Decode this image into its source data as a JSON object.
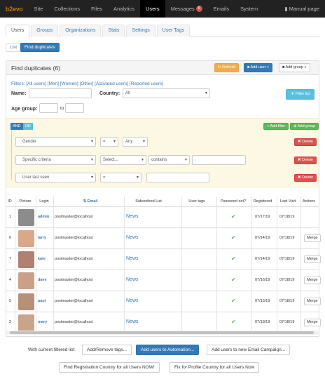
{
  "topbar": {
    "logo": "b2evo",
    "items": [
      "Site",
      "Collections",
      "Files",
      "Analytics",
      "Users",
      "Messages",
      "Emails",
      "System"
    ],
    "messages_badge": "6",
    "manual": "Manual page"
  },
  "tabs": [
    "Users",
    "Groups",
    "Organizations",
    "Stats",
    "Settings",
    "User Tags"
  ],
  "subtabs": [
    "List",
    "Find duplicates"
  ],
  "panel": {
    "title": "Find duplicates (6)",
    "refresh": "Refresh",
    "add_user": "Add user »",
    "add_group": "Add group »"
  },
  "filters": {
    "label": "Filters:",
    "links": [
      "[All users]",
      "[Men]",
      "[Women]",
      "[Other]",
      "[Activated users]",
      "[Reported users]"
    ],
    "name_label": "Name:",
    "country_label": "Country:",
    "country_value": "All",
    "filter_btn": "Filter list",
    "age_label": "Age group:",
    "age_to": "to"
  },
  "query": {
    "and": "AND",
    "or": "OR",
    "add_filter": "Add filter",
    "add_group": "Add group",
    "rules": [
      {
        "field": "Gender",
        "op": "=",
        "value": "Any",
        "extra": "",
        "delete": "Delete"
      },
      {
        "field": "Specific criteria",
        "op": "Select...",
        "value": "contains",
        "extra": "",
        "delete": "Delete"
      },
      {
        "field": "User last seen",
        "op": "=",
        "value": "",
        "extra": "",
        "delete": "Delete"
      }
    ]
  },
  "table": {
    "headers": [
      "ID",
      "Picture",
      "Login",
      "Email",
      "Subscribed List",
      "User tags",
      "Password set?",
      "Registered",
      "Last Visit",
      "Actions"
    ],
    "rows": [
      {
        "id": "1",
        "login": "admin",
        "email": "postmaster@localhost",
        "list": "News",
        "registered": "07/17/19",
        "last_visit": "07/18/19",
        "merge": ""
      },
      {
        "id": "6",
        "login": "larry",
        "email": "postmaster@localhost",
        "list": "News",
        "registered": "07/14/19",
        "last_visit": "07/18/19",
        "merge": "Merge"
      },
      {
        "id": "7",
        "login": "kate",
        "email": "postmaster@localhost",
        "list": "News",
        "registered": "07/14/19",
        "last_visit": "07/18/19",
        "merge": "Merge"
      },
      {
        "id": "4",
        "login": "dave",
        "email": "postmaster@localhost",
        "list": "News",
        "registered": "07/16/19",
        "last_visit": "07/18/19",
        "merge": "Merge"
      },
      {
        "id": "5",
        "login": "paul",
        "email": "postmaster@localhost",
        "list": "News",
        "registered": "07/15/19",
        "last_visit": "07/18/19",
        "merge": "Merge"
      },
      {
        "id": "2",
        "login": "mary",
        "email": "postmaster@localhost",
        "list": "News",
        "registered": "07/18/19",
        "last_visit": "07/18/19",
        "merge": "Merge"
      }
    ]
  },
  "footer": {
    "label": "With current filtered list:",
    "add_remove_tags": "Add/Remove tags...",
    "add_automation": "Add users to Automation...",
    "add_campaign": "Add users to new Email Campaign...",
    "find_country": "Find Registration Country for all Users NOW!",
    "fix_country": "Fix for Profile Country for all Users Now"
  },
  "colors": {
    "accent": "#337ab7",
    "orange": "#f0ad4e",
    "green": "#5cb85c",
    "red": "#d9534f"
  }
}
